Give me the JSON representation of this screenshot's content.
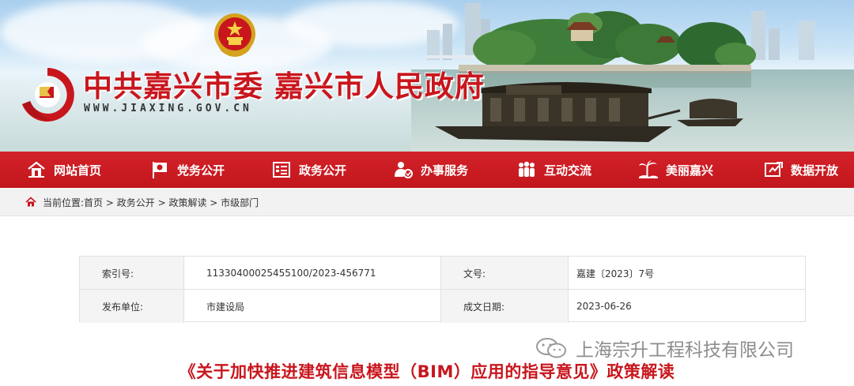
{
  "header": {
    "site_title": "中共嘉兴市委 嘉兴市人民政府",
    "site_url": "WWW.JIAXING.GOV.CN"
  },
  "nav": [
    {
      "label": "网站首页",
      "icon": "home-icon"
    },
    {
      "label": "党务公开",
      "icon": "party-flag-icon"
    },
    {
      "label": "政务公开",
      "icon": "document-list-icon"
    },
    {
      "label": "办事服务",
      "icon": "service-person-icon"
    },
    {
      "label": "互动交流",
      "icon": "people-group-icon"
    },
    {
      "label": "美丽嘉兴",
      "icon": "palm-tree-icon"
    },
    {
      "label": "数据开放",
      "icon": "data-open-icon"
    }
  ],
  "breadcrumb": {
    "prefix": "当前位置:",
    "items": [
      "首页",
      "政务公开",
      "政策解读",
      "市级部门"
    ],
    "separator": " > "
  },
  "info": {
    "index_label": "索引号:",
    "index_value": "11330400025455100/2023-456771",
    "doc_no_label": "文号:",
    "doc_no_value": "嘉建〔2023〕7号",
    "publisher_label": "发布单位:",
    "publisher_value": "市建设局",
    "date_label": "成文日期:",
    "date_value": "2023-06-26"
  },
  "article": {
    "title": "《关于加快推进建筑信息模型（BIM）应用的指导意见》政策解读"
  },
  "watermark": {
    "text": "上海宗升工程科技有限公司"
  },
  "colors": {
    "brand_red": "#c8161d",
    "nav_red": "#cc1d24",
    "crumb_bg": "#f2f2f2",
    "label_bg": "#f4f4f4"
  }
}
